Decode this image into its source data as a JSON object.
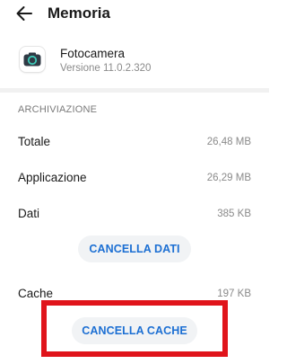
{
  "header": {
    "title": "Memoria",
    "back_icon": "arrow-left-icon"
  },
  "app": {
    "name": "Fotocamera",
    "version": "Versione 11.0.2.320",
    "icon": "camera-icon"
  },
  "storage": {
    "section_title": "ARCHIVIAZIONE",
    "rows": [
      {
        "label": "Totale",
        "value": "26,48 MB"
      },
      {
        "label": "Applicazione",
        "value": "26,29 MB"
      },
      {
        "label": "Dati",
        "value": "385 KB"
      }
    ],
    "clear_data_label": "CANCELLA DATI",
    "cache_row": {
      "label": "Cache",
      "value": "197 KB"
    },
    "clear_cache_label": "CANCELLA CACHE"
  },
  "colors": {
    "accent": "#1c6fd3",
    "button_bg": "#f1f3f5",
    "highlight": "#e0141b",
    "camera_icon_bg": "#2f3a45",
    "camera_lens": "#3ec9b7"
  }
}
